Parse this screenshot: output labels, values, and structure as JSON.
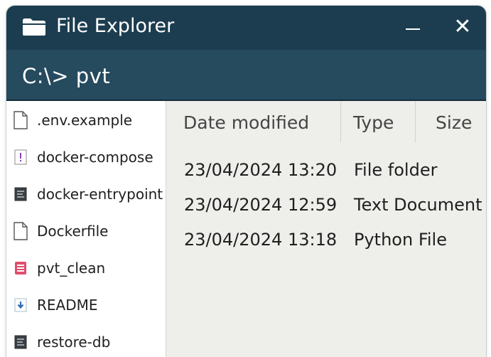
{
  "window": {
    "title": "File Explorer",
    "title_icon": "folder-icon",
    "minimize_icon": "minimize-icon",
    "close_symbol": "✕",
    "close_icon": "close-icon"
  },
  "path": {
    "text": "C:\\> pvt"
  },
  "files": [
    {
      "name": ".env.example",
      "icon": "blank-file-icon"
    },
    {
      "name": "docker-compose",
      "icon": "yaml-file-icon"
    },
    {
      "name": "docker-entrypoint",
      "icon": "script-file-icon"
    },
    {
      "name": "Dockerfile",
      "icon": "blank-file-icon"
    },
    {
      "name": "pvt_clean",
      "icon": "database-file-icon"
    },
    {
      "name": "README",
      "icon": "markdown-file-icon"
    },
    {
      "name": "restore-db",
      "icon": "script-file-icon"
    }
  ],
  "columns": {
    "date": "Date modified",
    "type": "Type",
    "size": "Size"
  },
  "rows": [
    {
      "date": "23/04/2024 13:20",
      "type": "File folder"
    },
    {
      "date": "23/04/2024 12:59",
      "type": "Text Document"
    },
    {
      "date": "23/04/2024 13:18",
      "type": "Python File"
    }
  ],
  "colors": {
    "titlebar": "#1c3d4f",
    "pathbar": "#264a5e",
    "sidebar": "#ffffff",
    "main": "#eeeeeb"
  }
}
